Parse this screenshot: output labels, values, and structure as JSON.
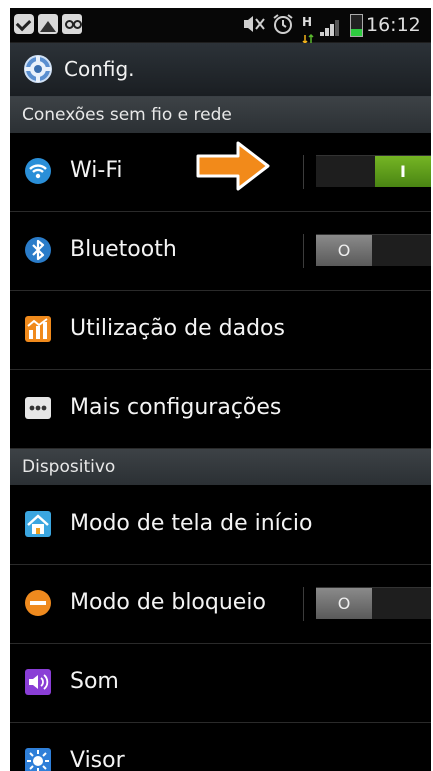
{
  "status_bar": {
    "time": "16:12",
    "h_indicator": "H",
    "icons": [
      "check-icon",
      "gallery-icon",
      "voicemail-icon",
      "mute-icon",
      "alarm-icon",
      "data-icon",
      "signal-icon",
      "battery-icon"
    ]
  },
  "header": {
    "title": "Config."
  },
  "sections": [
    {
      "title": "Conexões sem fio e rede"
    },
    {
      "title": "Dispositivo"
    }
  ],
  "items": [
    {
      "label": "Wi-Fi",
      "icon": "wifi-icon",
      "toggle": "on",
      "toggle_on_text": "I"
    },
    {
      "label": "Bluetooth",
      "icon": "bluetooth-icon",
      "toggle": "off",
      "toggle_off_text": "O"
    },
    {
      "label": "Utilização de dados",
      "icon": "data-usage-icon"
    },
    {
      "label": "Mais configurações",
      "icon": "more-icon"
    },
    {
      "label": "Modo de tela de início",
      "icon": "home-screen-icon"
    },
    {
      "label": "Modo de bloqueio",
      "icon": "blocking-icon",
      "toggle": "off",
      "toggle_off_text": "O"
    },
    {
      "label": "Som",
      "icon": "sound-icon"
    },
    {
      "label": "Visor",
      "icon": "display-icon"
    }
  ],
  "colors": {
    "toggle_on": "#5da01c",
    "arrow": "#f28a1a",
    "background": "#000000"
  }
}
